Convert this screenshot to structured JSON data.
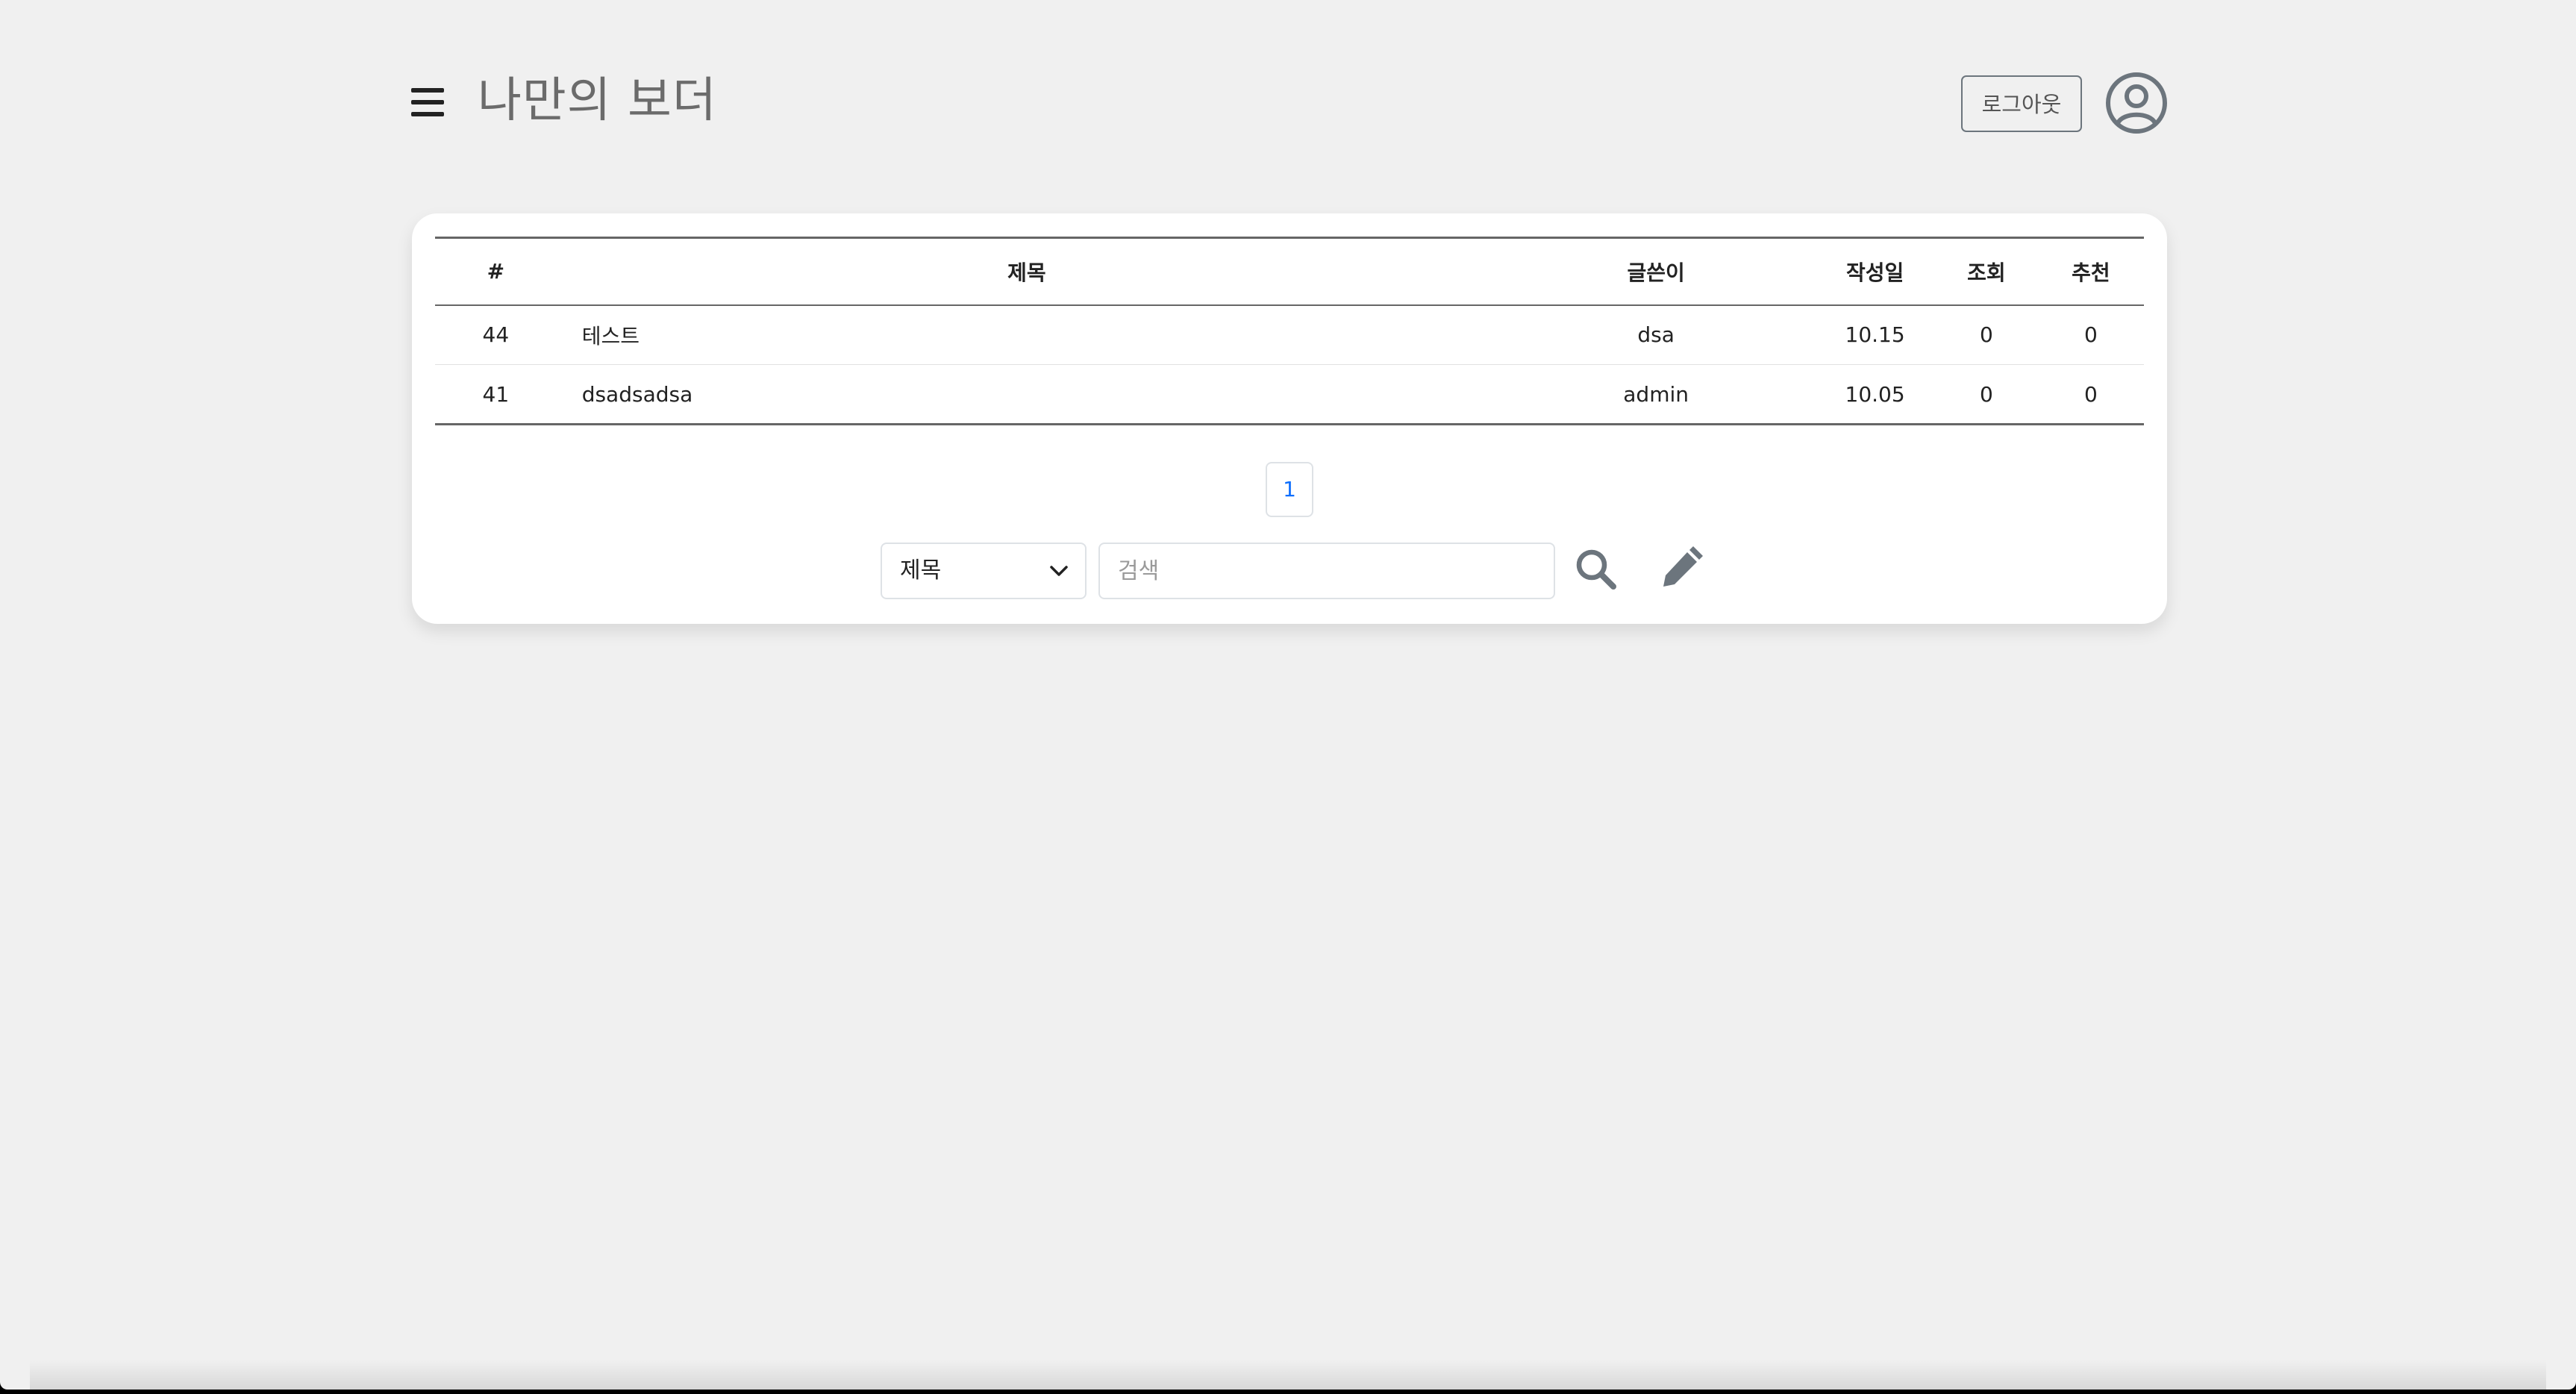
{
  "header": {
    "title": "나만의 보더",
    "menu_icon": "hamburger-menu-icon",
    "logout_label": "로그아웃",
    "user_icon": "user-circle-icon"
  },
  "board": {
    "columns": {
      "num": "#",
      "title": "제목",
      "writer": "글쓴이",
      "date": "작성일",
      "views": "조회",
      "likes": "추천"
    },
    "rows": [
      {
        "num": "44",
        "title": "테스트",
        "writer": "dsa",
        "date": "10.15",
        "views": "0",
        "likes": "0"
      },
      {
        "num": "41",
        "title": "dsadsadsa",
        "writer": "admin",
        "date": "10.05",
        "views": "0",
        "likes": "0"
      }
    ]
  },
  "pagination": {
    "current_page": "1"
  },
  "search": {
    "selected_field": "제목",
    "placeholder": "검색",
    "value": "",
    "search_icon": "search-icon",
    "write_icon": "pencil-icon"
  },
  "colors": {
    "background": "#f0f0f0",
    "card": "#ffffff",
    "page_link": "#0d6efd",
    "icon_gray": "#6c757d"
  }
}
